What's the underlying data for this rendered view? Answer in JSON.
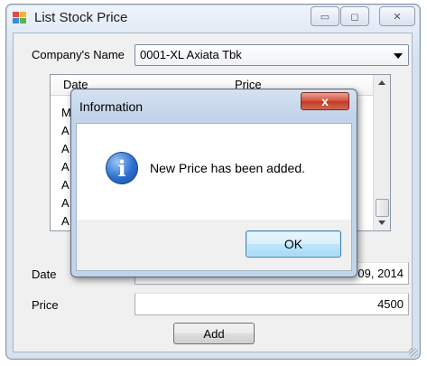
{
  "window": {
    "title": "List Stock Price"
  },
  "company": {
    "label": "Company's Name",
    "selected": "0001-XL Axiata Tbk"
  },
  "grid": {
    "columns": [
      "Date",
      "Price"
    ],
    "rows": [
      "M",
      "A",
      "A",
      "A",
      "A",
      "A",
      "A"
    ]
  },
  "form": {
    "date_label": "Date",
    "date_value": "09, 2014",
    "price_label": "Price",
    "price_value": "4500",
    "add_label": "Add"
  },
  "dialog": {
    "title": "Information",
    "message": "New Price has been added.",
    "ok_label": "OK",
    "close_glyph": "x",
    "icon_glyph": "i"
  },
  "colors": {
    "info_icon": "#2b6fcf",
    "close_button": "#c13a24",
    "ok_button": "#bee6fd"
  },
  "icons": {
    "app": "app-grid-icon",
    "info": "information-icon"
  }
}
